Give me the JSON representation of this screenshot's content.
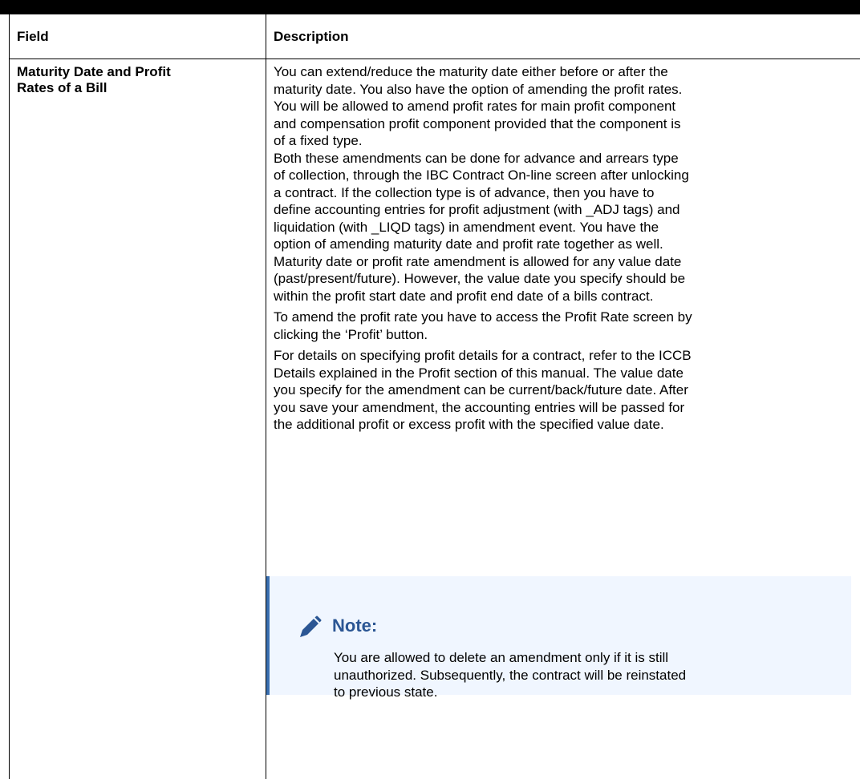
{
  "table": {
    "header": {
      "field": "Field",
      "description": "Description"
    },
    "row": {
      "field_lines": [
        "Maturity Date and Profit",
        "Rates of a Bill"
      ],
      "paragraphs": [
        [
          "You can extend/reduce the maturity date either before or after the",
          "maturity date. You also have the option of amending the profit rates.",
          "You will be allowed to amend profit rates for main profit component",
          "and compensation profit component provided that the component is",
          "of a fixed type.",
          "Both these amendments can be done for advance and arrears type",
          "of collection, through the IBC Contract On-line screen after unlocking",
          "a contract. If the collection type is of advance, then you have to",
          "define accounting entries for profit adjustment (with _ADJ tags) and",
          "liquidation (with _LIQD tags) in amendment event. You have the",
          "option of amending maturity date and profit rate together as well.",
          "Maturity date or profit rate amendment is allowed for any value date",
          "(past/present/future). However, the value date you specify should be",
          "within the profit start date and profit end date of a bills contract."
        ],
        [
          "To amend the profit rate you have to access the Profit Rate screen by",
          "clicking the ‘Profit’ button."
        ],
        [
          "For details on specifying profit details for a contract, refer to the ICCB",
          "Details explained in the Profit section of this manual. The value date",
          "you specify for the amendment can be current/back/future date. After",
          "you save your amendment, the accounting entries will be passed for",
          "the additional profit or excess profit with the specified value date."
        ]
      ],
      "note": {
        "icon": "pencil-icon",
        "title": "Note:",
        "lines": [
          "You are allowed to delete an amendment only if it is still",
          "unauthorized. Subsequently, the contract will be reinstated",
          "to previous state."
        ]
      }
    }
  },
  "colors": {
    "note_background": "#f0f6ff",
    "note_accent": "#3a6fb0",
    "note_title": "#2b5694"
  }
}
